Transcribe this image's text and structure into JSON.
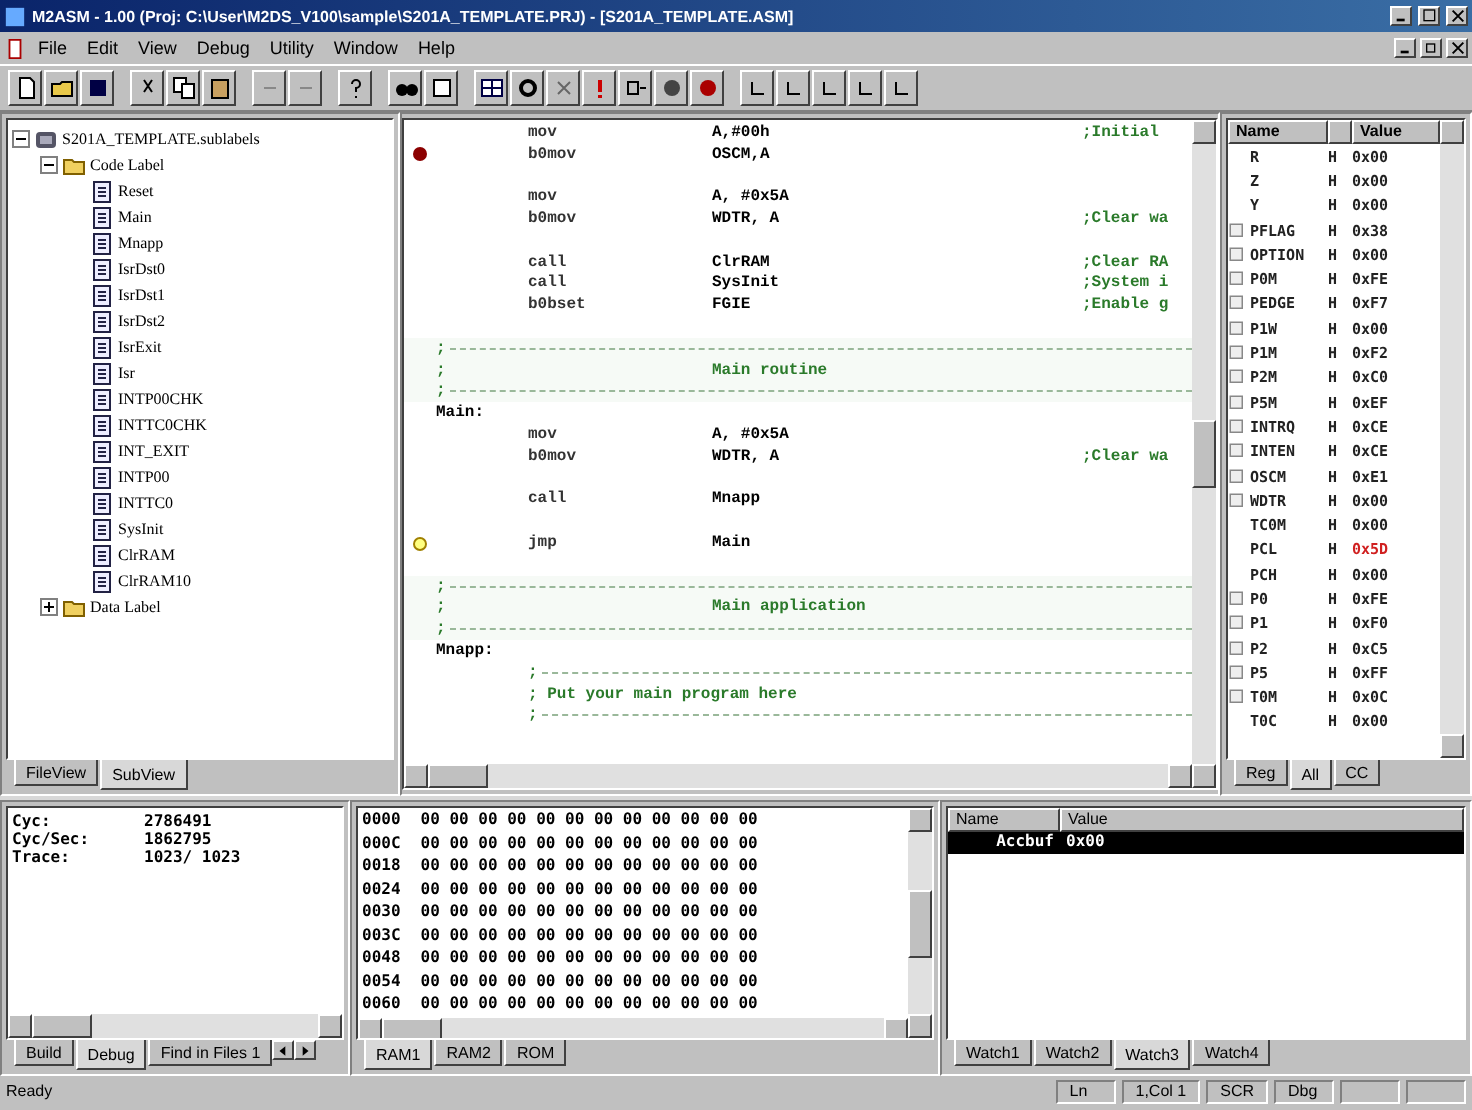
{
  "window": {
    "title": "M2ASM - 1.00 (Proj: C:\\User\\M2DS_V100\\sample\\S201A_TEMPLATE.PRJ) - [S201A_TEMPLATE.ASM]"
  },
  "menu": [
    "File",
    "Edit",
    "View",
    "Debug",
    "Utility",
    "Window",
    "Help"
  ],
  "project_tree": {
    "items": [
      {
        "kind": "project",
        "label": "S201A_TEMPLATE.sublabels",
        "expanded": true,
        "children": [
          {
            "kind": "folder",
            "label": "Code Label",
            "expanded": true,
            "children": [
              {
                "kind": "label",
                "label": "Reset"
              },
              {
                "kind": "label",
                "label": "Main"
              },
              {
                "kind": "label",
                "label": "Mnapp"
              },
              {
                "kind": "label",
                "label": "IsrDst0"
              },
              {
                "kind": "label",
                "label": "IsrDst1"
              },
              {
                "kind": "label",
                "label": "IsrDst2"
              },
              {
                "kind": "label",
                "label": "IsrExit"
              },
              {
                "kind": "label",
                "label": "Isr"
              },
              {
                "kind": "label",
                "label": "INTP00CHK"
              },
              {
                "kind": "label",
                "label": "INTTC0CHK"
              },
              {
                "kind": "label",
                "label": "INT_EXIT"
              },
              {
                "kind": "label",
                "label": "INTP00"
              },
              {
                "kind": "label",
                "label": "INTTC0"
              },
              {
                "kind": "label",
                "label": "SysInit"
              },
              {
                "kind": "label",
                "label": "ClrRAM"
              },
              {
                "kind": "label",
                "label": "ClrRAM10"
              }
            ]
          },
          {
            "kind": "folder",
            "label": "Data Label",
            "expanded": false
          }
        ]
      }
    ],
    "tabs": [
      {
        "label": "FileView",
        "selected": false
      },
      {
        "label": "SubView",
        "selected": true
      }
    ]
  },
  "editor": {
    "lines": [
      {
        "kind": "code",
        "op": "mov",
        "arg": "A,#00h",
        "comment": ";Initial",
        "breakpoint": false,
        "current": false
      },
      {
        "kind": "code",
        "op": "b0mov",
        "arg": "OSCM,A",
        "breakpoint": true,
        "current": false
      },
      {
        "kind": "blank"
      },
      {
        "kind": "code",
        "op": "mov",
        "arg": "A, #0x5A",
        "breakpoint": false,
        "current": false
      },
      {
        "kind": "code",
        "op": "b0mov",
        "arg": "WDTR, A",
        "comment": ";Clear wa",
        "breakpoint": false,
        "current": false
      },
      {
        "kind": "blank"
      },
      {
        "kind": "code",
        "op": "call",
        "arg": "ClrRAM",
        "comment": ";Clear RA",
        "breakpoint": false,
        "current": false
      },
      {
        "kind": "code",
        "op": "call",
        "arg": "SysInit",
        "comment": ";System i",
        "breakpoint": false,
        "current": false
      },
      {
        "kind": "code",
        "op": "b0bset",
        "arg": "FGIE",
        "comment": ";Enable g",
        "breakpoint": false,
        "current": false
      },
      {
        "kind": "blank"
      },
      {
        "kind": "rule",
        "text": ";"
      },
      {
        "kind": "banner",
        "text": ";",
        "title": "Main routine"
      },
      {
        "kind": "rule",
        "text": ";"
      },
      {
        "kind": "label",
        "text": "Main:"
      },
      {
        "kind": "code",
        "op": "mov",
        "arg": "A, #0x5A",
        "breakpoint": false,
        "current": false
      },
      {
        "kind": "code",
        "op": "b0mov",
        "arg": "WDTR, A",
        "comment": ";Clear wa",
        "breakpoint": false,
        "current": false
      },
      {
        "kind": "blank"
      },
      {
        "kind": "code",
        "op": "call",
        "arg": "Mnapp",
        "breakpoint": false,
        "current": false
      },
      {
        "kind": "blank"
      },
      {
        "kind": "code",
        "op": "jmp",
        "arg": "Main",
        "breakpoint": false,
        "current": true
      },
      {
        "kind": "blank"
      },
      {
        "kind": "rule",
        "text": ";"
      },
      {
        "kind": "banner",
        "text": ";",
        "title": "Main application"
      },
      {
        "kind": "rule",
        "text": ";"
      },
      {
        "kind": "label",
        "text": "Mnapp:"
      },
      {
        "kind": "inner_rule",
        "text": ";"
      },
      {
        "kind": "inner_comment",
        "text": "; Put your main program here"
      },
      {
        "kind": "inner_rule",
        "text": ";"
      }
    ]
  },
  "registers": {
    "columns": [
      "Name",
      "Value"
    ],
    "rows": [
      {
        "name": "R",
        "expandable": false,
        "radix": "H",
        "value": "0x00",
        "changed": false
      },
      {
        "name": "Z",
        "expandable": false,
        "radix": "H",
        "value": "0x00",
        "changed": false
      },
      {
        "name": "Y",
        "expandable": false,
        "radix": "H",
        "value": "0x00",
        "changed": false
      },
      {
        "name": "PFLAG",
        "expandable": true,
        "radix": "H",
        "value": "0x38",
        "changed": false
      },
      {
        "name": "OPTION",
        "expandable": true,
        "radix": "H",
        "value": "0x00",
        "changed": false
      },
      {
        "name": "P0M",
        "expandable": true,
        "radix": "H",
        "value": "0xFE",
        "changed": false
      },
      {
        "name": "PEDGE",
        "expandable": true,
        "radix": "H",
        "value": "0xF7",
        "changed": false
      },
      {
        "name": "P1W",
        "expandable": true,
        "radix": "H",
        "value": "0x00",
        "changed": false
      },
      {
        "name": "P1M",
        "expandable": true,
        "radix": "H",
        "value": "0xF2",
        "changed": false
      },
      {
        "name": "P2M",
        "expandable": true,
        "radix": "H",
        "value": "0xC0",
        "changed": false
      },
      {
        "name": "P5M",
        "expandable": true,
        "radix": "H",
        "value": "0xEF",
        "changed": false
      },
      {
        "name": "INTRQ",
        "expandable": true,
        "radix": "H",
        "value": "0xCE",
        "changed": false
      },
      {
        "name": "INTEN",
        "expandable": true,
        "radix": "H",
        "value": "0xCE",
        "changed": false
      },
      {
        "name": "OSCM",
        "expandable": true,
        "radix": "H",
        "value": "0xE1",
        "changed": false
      },
      {
        "name": "WDTR",
        "expandable": true,
        "radix": "H",
        "value": "0x00",
        "changed": false
      },
      {
        "name": "TC0M",
        "expandable": false,
        "radix": "H",
        "value": "0x00",
        "changed": false
      },
      {
        "name": "PCL",
        "expandable": false,
        "radix": "H",
        "value": "0x5D",
        "changed": true
      },
      {
        "name": "PCH",
        "expandable": false,
        "radix": "H",
        "value": "0x00",
        "changed": false
      },
      {
        "name": "P0",
        "expandable": true,
        "radix": "H",
        "value": "0xFE",
        "changed": false
      },
      {
        "name": "P1",
        "expandable": true,
        "radix": "H",
        "value": "0xF0",
        "changed": false
      },
      {
        "name": "P2",
        "expandable": true,
        "radix": "H",
        "value": "0xC5",
        "changed": false
      },
      {
        "name": "P5",
        "expandable": true,
        "radix": "H",
        "value": "0xFF",
        "changed": false
      },
      {
        "name": "T0M",
        "expandable": true,
        "radix": "H",
        "value": "0x0C",
        "changed": false
      },
      {
        "name": "T0C",
        "expandable": false,
        "radix": "H",
        "value": "0x00",
        "changed": false
      }
    ],
    "tabs": [
      {
        "label": "Reg",
        "selected": false
      },
      {
        "label": "All",
        "selected": true
      },
      {
        "label": "CC",
        "selected": false
      }
    ]
  },
  "output": {
    "lines": [
      {
        "label": "Cyc:",
        "value": "2786491"
      },
      {
        "label": "Cyc/Sec:",
        "value": "1862795"
      },
      {
        "label": "Trace:",
        "value": "1023/ 1023"
      }
    ],
    "tabs": [
      {
        "label": "Build",
        "selected": false
      },
      {
        "label": "Debug",
        "selected": true
      },
      {
        "label": "Find in Files 1",
        "selected": false
      }
    ]
  },
  "memory": {
    "rows": [
      {
        "address": "0000",
        "bytes": "00 00 00 00 00 00 00 00 00 00 00 00"
      },
      {
        "address": "000C",
        "bytes": "00 00 00 00 00 00 00 00 00 00 00 00"
      },
      {
        "address": "0018",
        "bytes": "00 00 00 00 00 00 00 00 00 00 00 00"
      },
      {
        "address": "0024",
        "bytes": "00 00 00 00 00 00 00 00 00 00 00 00"
      },
      {
        "address": "0030",
        "bytes": "00 00 00 00 00 00 00 00 00 00 00 00"
      },
      {
        "address": "003C",
        "bytes": "00 00 00 00 00 00 00 00 00 00 00 00"
      },
      {
        "address": "0048",
        "bytes": "00 00 00 00 00 00 00 00 00 00 00 00"
      },
      {
        "address": "0054",
        "bytes": "00 00 00 00 00 00 00 00 00 00 00 00"
      },
      {
        "address": "0060",
        "bytes": "00 00 00 00 00 00 00 00 00 00 00 00"
      }
    ],
    "tabs": [
      {
        "label": "RAM1",
        "selected": true
      },
      {
        "label": "RAM2",
        "selected": false
      },
      {
        "label": "ROM",
        "selected": false
      }
    ]
  },
  "watch": {
    "columns": [
      "Name",
      "Value"
    ],
    "rows": [
      {
        "name": "Accbuf",
        "value": "0x00",
        "selected": true
      }
    ],
    "tabs": [
      {
        "label": "Watch1",
        "selected": false
      },
      {
        "label": "Watch2",
        "selected": false
      },
      {
        "label": "Watch3",
        "selected": true
      },
      {
        "label": "Watch4",
        "selected": false
      }
    ]
  },
  "status_bar": {
    "message": "Ready",
    "panes": [
      "Ln",
      "1,Col 1",
      "SCR",
      "Dbg"
    ]
  }
}
